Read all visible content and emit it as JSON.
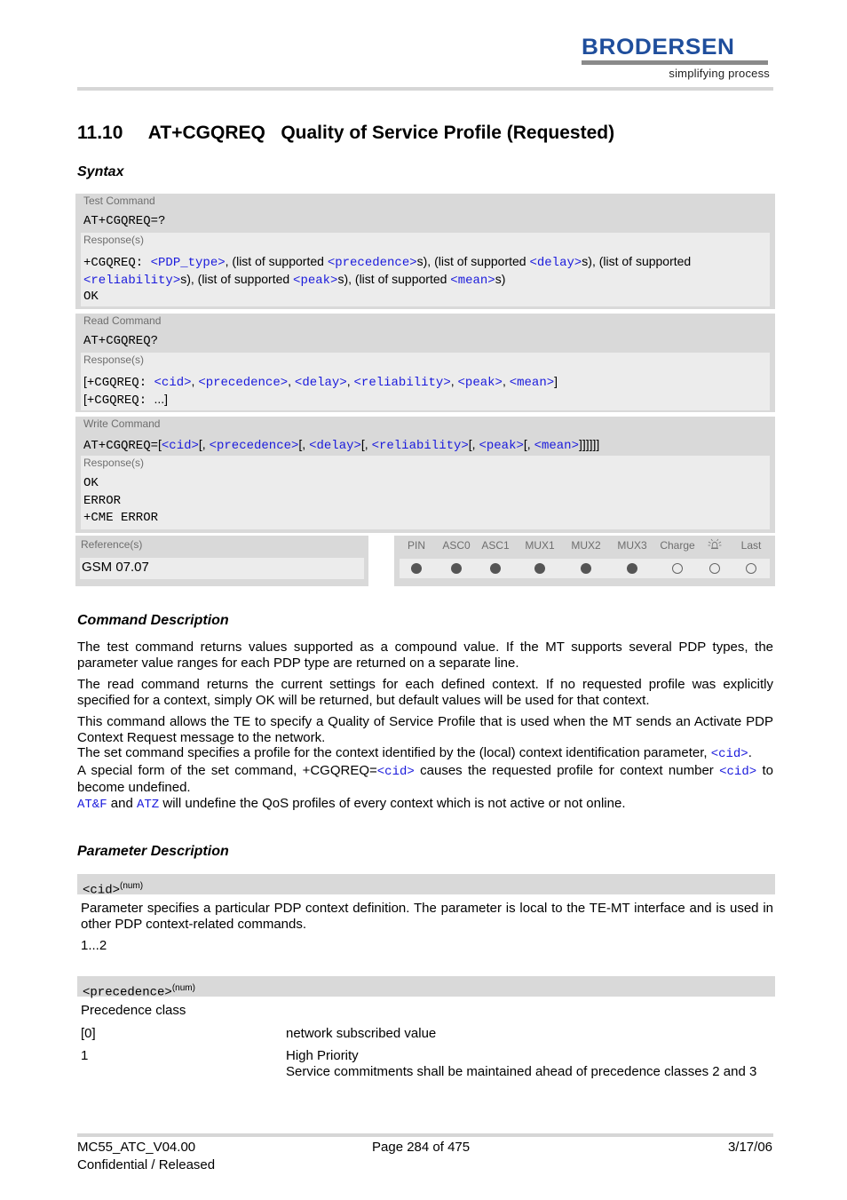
{
  "header": {
    "logo_word": "BRODERSEN",
    "logo_tagline": "simplifying process",
    "brand_color": "#1f4e9c"
  },
  "title": "11.10     AT+CGQREQ   Quality of Service Profile (Requested)",
  "syntax_heading": "Syntax",
  "test_command": {
    "label": "Test Command",
    "command": "AT+CGQREQ=?",
    "response_label": "Response(s)",
    "resp_prefix": "+CGQREQ: ",
    "p_pdp_type": "<PDP_type>",
    "t1": ", (list of supported ",
    "p_precedence": "<precedence>",
    "t2": "s), (list of supported ",
    "p_delay": "<delay>",
    "t3": "s), (list of supported ",
    "p_reliability": "<reliability>",
    "t4": "s), (list of supported ",
    "p_peak": "<peak>",
    "t5": "s), (list of supported ",
    "p_mean": "<mean>",
    "t6": "s)",
    "ok": "OK"
  },
  "read_command": {
    "label": "Read Command",
    "command": "AT+CGQREQ?",
    "response_label": "Response(s)",
    "open": "[",
    "resp_prefix": "+CGQREQ: ",
    "p_cid": "<cid>",
    "p_precedence": "<precedence>",
    "p_delay": "<delay>",
    "p_reliability": "<reliability>",
    "p_peak": "<peak>",
    "p_mean": "<mean>",
    "sep": ", ",
    "close": "]",
    "line2_prefix": "[",
    "line2_cmd": "+CGQREQ: ",
    "line2_rest": "...]"
  },
  "write_command": {
    "label": "Write Command",
    "cmd_prefix": "AT+CGQREQ=",
    "open": "[",
    "p_cid": "<cid>",
    "p_precedence": "<precedence>",
    "p_delay": "<delay>",
    "p_reliability": "<reliability>",
    "p_peak": "<peak>",
    "p_mean": "<mean>",
    "sep": "[, ",
    "close": "]]]]]]",
    "response_label": "Response(s)",
    "responses": [
      "OK",
      "ERROR",
      "+CME ERROR"
    ]
  },
  "reference": {
    "label": "Reference(s)",
    "value": "GSM 07.07"
  },
  "interfaces": {
    "columns": [
      {
        "label": "PIN",
        "supported": true
      },
      {
        "label": "ASC0",
        "supported": true
      },
      {
        "label": "ASC1",
        "supported": true
      },
      {
        "label": "MUX1",
        "supported": true
      },
      {
        "label": "MUX2",
        "supported": true
      },
      {
        "label": "MUX3",
        "supported": true
      },
      {
        "label": "Charge",
        "supported": false
      },
      {
        "label": "alarm-icon",
        "supported": false
      },
      {
        "label": "Last",
        "supported": false
      }
    ]
  },
  "command_description": {
    "heading": "Command Description",
    "p1": "The test command returns values supported as a compound value. If the MT supports several PDP types, the parameter value ranges for each PDP type are returned on a separate line.",
    "p2": "The read command returns the current settings for each defined context. If no requested profile was explicitly specified for a context, simply OK will be returned, but default values will be used for that context.",
    "p3": "This command allows the TE to specify a Quality of Service Profile that is used when the MT sends an Activate PDP Context Request message to the network.",
    "p4_text": "The set command specifies a profile for the context identified by the (local) context identification parameter, ",
    "p4_link": "<cid>",
    "p4_end": ".",
    "p5_text1": "A special form of the set command, +CGQREQ=",
    "p5_link1": "<cid>",
    "p5_text2": " causes the requested profile for context number ",
    "p5_link2": "<cid>",
    "p5_text3": " to become undefined.",
    "p6_link1": "AT&F",
    "p6_text1": " and ",
    "p6_link2": "ATZ",
    "p6_text2": " will undefine the QoS profiles of every context which is not active or not online."
  },
  "parameter_description": {
    "heading": "Parameter Description",
    "cid": {
      "name": "<cid>",
      "type": "(num)",
      "description": "Parameter specifies a particular PDP context definition. The parameter is local to the TE-MT interface and is used in other PDP context-related commands.",
      "range": "1...2"
    },
    "precedence": {
      "name": "<precedence>",
      "type": "(num)",
      "description": "Precedence class",
      "values": [
        {
          "value": "[0]",
          "meaning": "network subscribed value"
        },
        {
          "value": "1",
          "meaning": "High Priority",
          "detail": "Service commitments shall be maintained ahead of precedence classes 2 and 3"
        }
      ]
    }
  },
  "footer": {
    "doc_id": "MC55_ATC_V04.00",
    "status": "Confidential / Released",
    "page": "Page 284 of 475",
    "date": "3/17/06"
  }
}
